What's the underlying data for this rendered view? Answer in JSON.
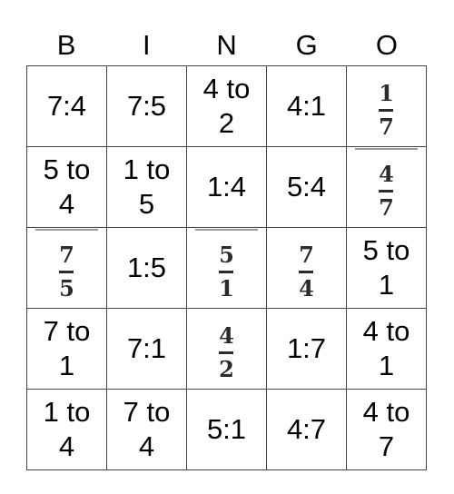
{
  "header": [
    "B",
    "I",
    "N",
    "G",
    "O"
  ],
  "rows": [
    [
      {
        "type": "text",
        "lines": [
          "7:4"
        ]
      },
      {
        "type": "text",
        "lines": [
          "7:5"
        ]
      },
      {
        "type": "text",
        "lines": [
          "4 to",
          "2"
        ]
      },
      {
        "type": "text",
        "lines": [
          "4:1"
        ]
      },
      {
        "type": "frac",
        "num": "1",
        "den": "7"
      }
    ],
    [
      {
        "type": "text",
        "lines": [
          "5 to",
          "4"
        ]
      },
      {
        "type": "text",
        "lines": [
          "1 to",
          "5"
        ]
      },
      {
        "type": "text",
        "lines": [
          "1:4"
        ]
      },
      {
        "type": "text",
        "lines": [
          "5:4"
        ]
      },
      {
        "type": "frac",
        "num": "4",
        "den": "7",
        "artifact": true
      }
    ],
    [
      {
        "type": "frac",
        "num": "7",
        "den": "5",
        "artifact": true
      },
      {
        "type": "text",
        "lines": [
          "1:5"
        ]
      },
      {
        "type": "frac",
        "num": "5",
        "den": "1",
        "artifact": true
      },
      {
        "type": "frac",
        "num": "7",
        "den": "4"
      },
      {
        "type": "text",
        "lines": [
          "5 to",
          "1"
        ]
      }
    ],
    [
      {
        "type": "text",
        "lines": [
          "7 to",
          "1"
        ]
      },
      {
        "type": "text",
        "lines": [
          "7:1"
        ]
      },
      {
        "type": "frac",
        "num": "4",
        "den": "2"
      },
      {
        "type": "text",
        "lines": [
          "1:7"
        ]
      },
      {
        "type": "text",
        "lines": [
          "4 to",
          "1"
        ]
      }
    ],
    [
      {
        "type": "text",
        "lines": [
          "1 to",
          "4"
        ]
      },
      {
        "type": "text",
        "lines": [
          "7 to",
          "4"
        ]
      },
      {
        "type": "text",
        "lines": [
          "5:1"
        ]
      },
      {
        "type": "text",
        "lines": [
          "4:7"
        ]
      },
      {
        "type": "text",
        "lines": [
          "4 to",
          "7"
        ]
      }
    ]
  ]
}
